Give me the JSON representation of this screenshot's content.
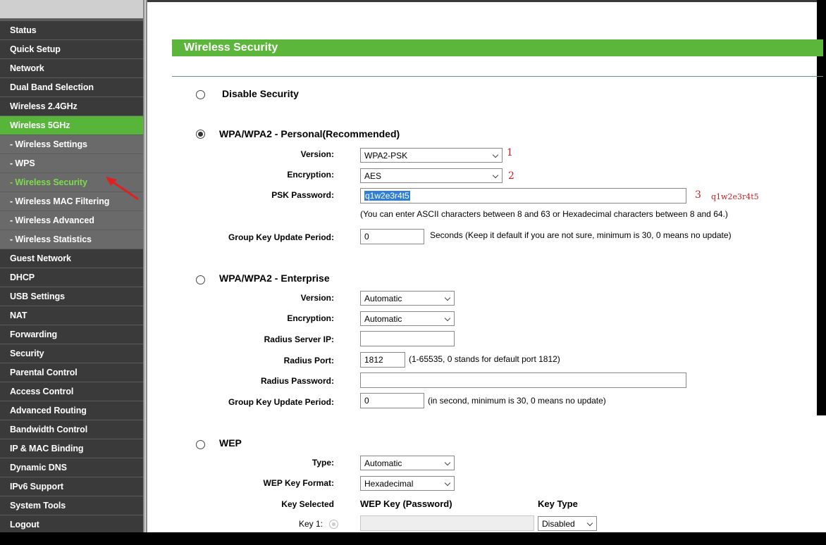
{
  "sidebar": {
    "items": [
      {
        "label": "Status",
        "type": "top"
      },
      {
        "label": "Quick Setup",
        "type": "top"
      },
      {
        "label": "Network",
        "type": "top"
      },
      {
        "label": "Dual Band Selection",
        "type": "top"
      },
      {
        "label": "Wireless 2.4GHz",
        "type": "top"
      },
      {
        "label": "Wireless 5GHz",
        "type": "open"
      },
      {
        "label": "- Wireless Settings",
        "type": "sub"
      },
      {
        "label": "- WPS",
        "type": "sub"
      },
      {
        "label": "- Wireless Security",
        "type": "selected"
      },
      {
        "label": "- Wireless MAC Filtering",
        "type": "sub"
      },
      {
        "label": "- Wireless Advanced",
        "type": "sub"
      },
      {
        "label": "- Wireless Statistics",
        "type": "sub"
      },
      {
        "label": "Guest Network",
        "type": "top"
      },
      {
        "label": "DHCP",
        "type": "top"
      },
      {
        "label": "USB Settings",
        "type": "top"
      },
      {
        "label": "NAT",
        "type": "top"
      },
      {
        "label": "Forwarding",
        "type": "top"
      },
      {
        "label": "Security",
        "type": "top"
      },
      {
        "label": "Parental Control",
        "type": "top"
      },
      {
        "label": "Access Control",
        "type": "top"
      },
      {
        "label": "Advanced Routing",
        "type": "top"
      },
      {
        "label": "Bandwidth Control",
        "type": "top"
      },
      {
        "label": "IP & MAC Binding",
        "type": "top"
      },
      {
        "label": "Dynamic DNS",
        "type": "top"
      },
      {
        "label": "IPv6 Support",
        "type": "top"
      },
      {
        "label": "System Tools",
        "type": "top"
      },
      {
        "label": "Logout",
        "type": "top"
      }
    ]
  },
  "page": {
    "title": "Wireless Security"
  },
  "disable": {
    "label": "Disable Security",
    "checked": false
  },
  "personal": {
    "title": "WPA/WPA2 - Personal(Recommended)",
    "checked": true,
    "version_label": "Version:",
    "version_value": "WPA2-PSK",
    "encryption_label": "Encryption:",
    "encryption_value": "AES",
    "psk_label": "PSK Password:",
    "psk_value": "q1w2e3r4t5",
    "psk_hint": "(You can enter ASCII characters between 8 and 63 or Hexadecimal characters between 8 and 64.)",
    "gkup_label": "Group Key Update Period:",
    "gkup_value": "0",
    "gkup_hint": "Seconds (Keep it default if you are not sure, minimum is 30, 0 means no update)"
  },
  "enterprise": {
    "title": "WPA/WPA2 - Enterprise",
    "checked": false,
    "version_label": "Version:",
    "version_value": "Automatic",
    "encryption_label": "Encryption:",
    "encryption_value": "Automatic",
    "radius_ip_label": "Radius Server IP:",
    "radius_ip_value": "",
    "radius_port_label": "Radius Port:",
    "radius_port_value": "1812",
    "radius_port_hint": "(1-65535, 0 stands for default port 1812)",
    "radius_pw_label": "Radius Password:",
    "radius_pw_value": "",
    "gkup_label": "Group Key Update Period:",
    "gkup_value": "0",
    "gkup_hint": "(in second, minimum is 30, 0 means no update)"
  },
  "wep": {
    "title": "WEP",
    "checked": false,
    "type_label": "Type:",
    "type_value": "Automatic",
    "format_label": "WEP Key Format:",
    "format_value": "Hexadecimal",
    "col_key_selected": "Key Selected",
    "col_wep_key": "WEP Key (Password)",
    "col_key_type": "Key Type",
    "key1_label": "Key 1:",
    "key1_value": "",
    "key1_type": "Disabled"
  },
  "annotations": {
    "a1": "1",
    "a2": "2",
    "a3": "3",
    "a3_text": "q1w2e3r4t5",
    "color": "#c02020"
  },
  "colors": {
    "accent_green": "#5cb63b",
    "sidebar_bg": "#3a3a3a",
    "sidebar_sub_bg": "#6a6a6a",
    "selected_text": "#7fdc4d"
  }
}
